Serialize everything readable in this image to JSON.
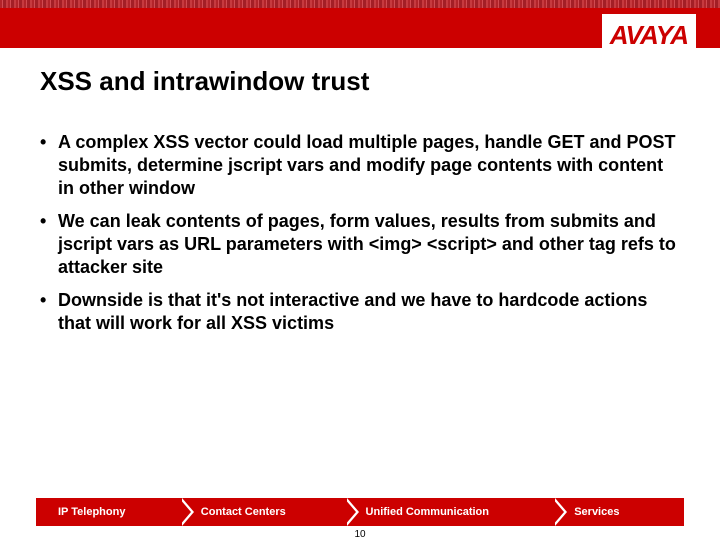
{
  "brand": {
    "name": "AVAYA",
    "color": "#cc0000"
  },
  "slide": {
    "title": "XSS and intrawindow trust",
    "bullets": [
      "A complex XSS vector could load multiple pages, handle GET and POST submits, determine jscript vars and modify page contents with content in other window",
      "We can leak contents of pages, form values, results from submits and jscript vars as URL parameters with <img> <script> and other tag refs to attacker site",
      "Downside is that it's not interactive and we have to hardcode actions that will work for all XSS victims"
    ]
  },
  "footer": {
    "segments": [
      "IP Telephony",
      "Contact Centers",
      "Unified Communication",
      "Services"
    ]
  },
  "page_number": "10"
}
